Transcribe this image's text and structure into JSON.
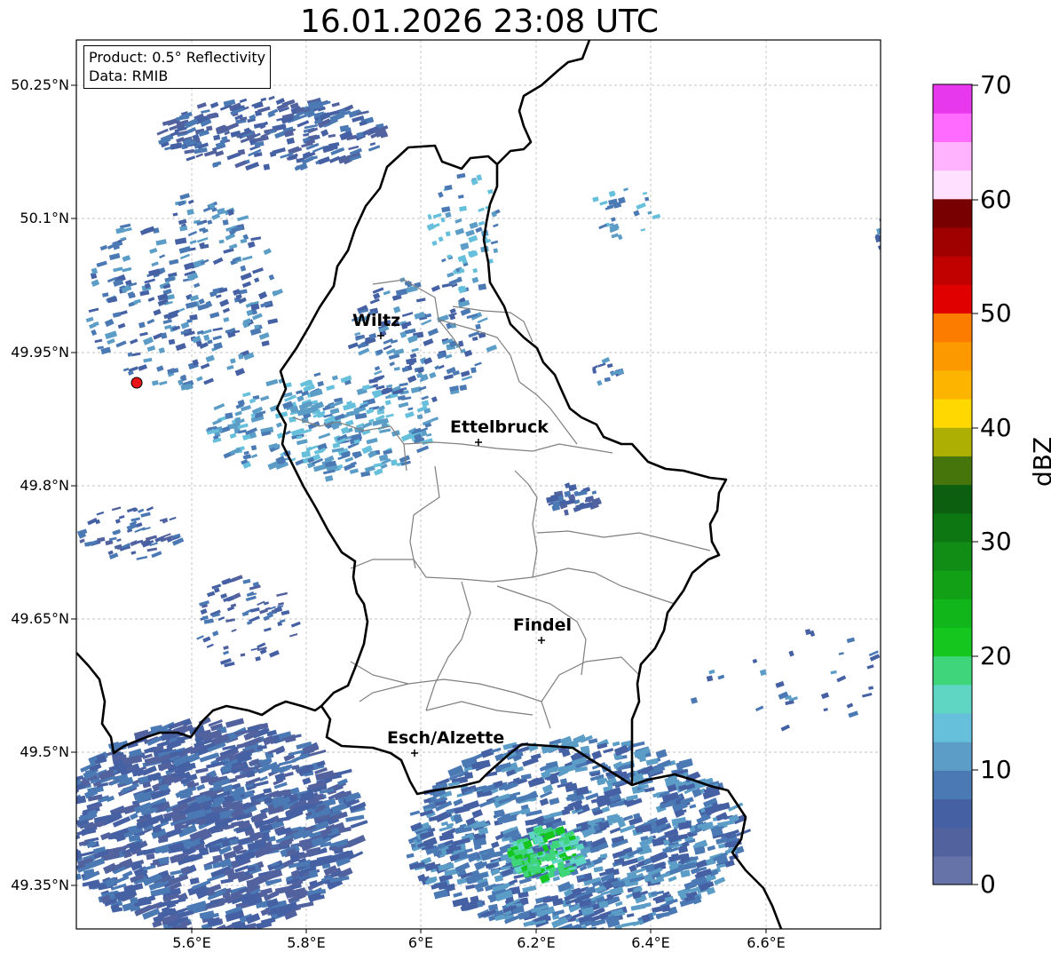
{
  "title": "16.01.2026 23:08 UTC",
  "info": {
    "product": "Product: 0.5° Reflectivity",
    "data_source": "Data: RMIB"
  },
  "axes": {
    "lat_labels": [
      "50.25°N",
      "50.1°N",
      "49.95°N",
      "49.8°N",
      "49.65°N",
      "49.5°N",
      "49.35°N"
    ],
    "lon_labels": [
      "5.6°E",
      "5.8°E",
      "6°E",
      "6.2°E",
      "6.4°E",
      "6.6°E"
    ]
  },
  "places": [
    {
      "name": "Wiltz"
    },
    {
      "name": "Ettelbruck"
    },
    {
      "name": "Findel"
    },
    {
      "name": "Esch/Alzette"
    }
  ],
  "radar_site": {
    "marker_color": "#e8141a"
  },
  "colorbar": {
    "label": "dBZ",
    "ticks": [
      "0",
      "10",
      "20",
      "30",
      "40",
      "50",
      "60",
      "70"
    ],
    "min": 0,
    "max": 70,
    "colors": [
      "#6573a8",
      "#52629e",
      "#4561a4",
      "#4a79b4",
      "#5b9dc6",
      "#66bfdb",
      "#5fd6c4",
      "#3fd57a",
      "#15c61f",
      "#11b71a",
      "#12a116",
      "#118d15",
      "#0d7712",
      "#0b5f0e",
      "#46760b",
      "#adb002",
      "#fed800",
      "#fdb400",
      "#fc9800",
      "#fc7c00",
      "#e00000",
      "#c10000",
      "#9f0000",
      "#780000",
      "#ffe0ff",
      "#ffb3ff",
      "#ff6bff",
      "#e838ee"
    ]
  }
}
